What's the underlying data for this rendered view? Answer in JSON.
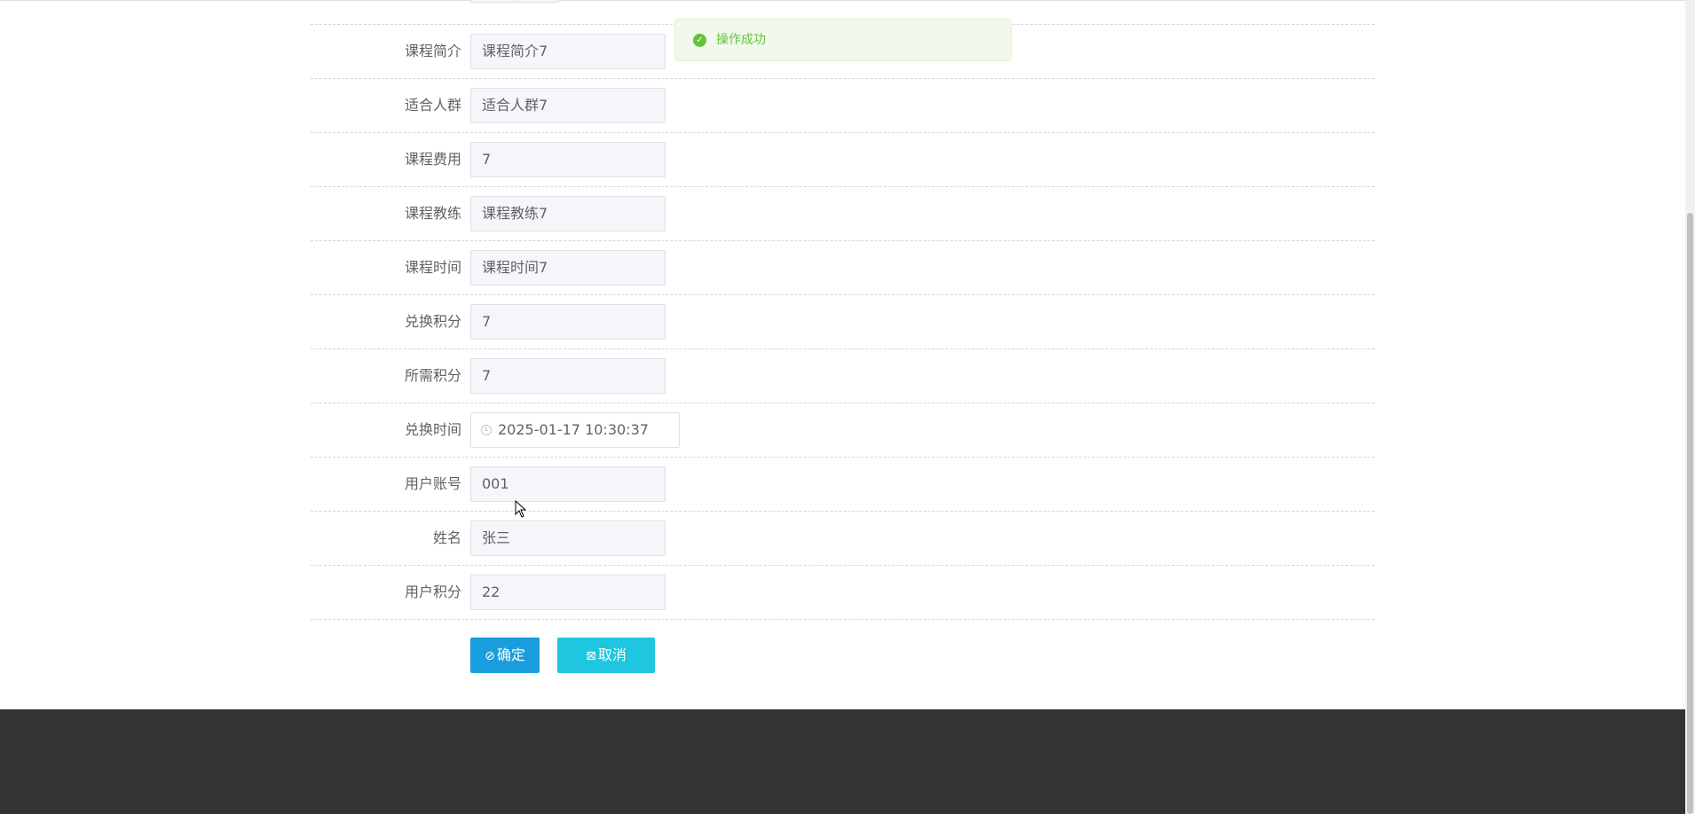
{
  "form": {
    "rows": [
      {
        "label": "课程简介",
        "value": "课程简介7"
      },
      {
        "label": "适合人群",
        "value": "适合人群7"
      },
      {
        "label": "课程费用",
        "value": "7"
      },
      {
        "label": "课程教练",
        "value": "课程教练7"
      },
      {
        "label": "课程时间",
        "value": "课程时间7"
      },
      {
        "label": "兑换积分",
        "value": "7"
      },
      {
        "label": "所需积分",
        "value": "7"
      },
      {
        "label": "兑换时间",
        "value": "2025-01-17 10:30:37"
      },
      {
        "label": "用户账号",
        "value": "001"
      },
      {
        "label": "姓名",
        "value": "张三"
      },
      {
        "label": "用户积分",
        "value": "22"
      }
    ]
  },
  "actions": {
    "confirm_label": "确定",
    "cancel_label": "取消"
  },
  "toast": {
    "message": "操作成功"
  },
  "colors": {
    "confirm_button": "#1a9ddc",
    "cancel_button": "#1ec6df",
    "success": "#67c23a",
    "footer": "#333333"
  },
  "icons": {
    "toast": "check-circle-icon",
    "date_field": "clock-icon",
    "confirm": "check-circle-icon",
    "cancel": "close-square-icon"
  }
}
